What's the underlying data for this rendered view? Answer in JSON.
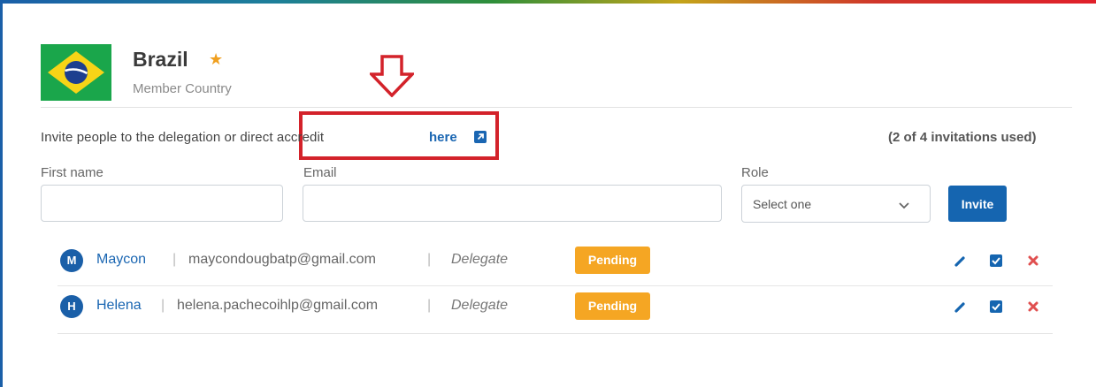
{
  "country": {
    "name": "Brazil",
    "star": "★",
    "subtitle": "Member Country"
  },
  "invite": {
    "text": "Invite people to the delegation or direct accredit",
    "link_label": "here",
    "usage": "(2 of 4 invitations used)"
  },
  "form": {
    "first_name_label": "First name",
    "first_name_value": "",
    "email_label": "Email",
    "email_value": "",
    "role_label": "Role",
    "role_selected": "Select one",
    "invite_button": "Invite"
  },
  "invitations": [
    {
      "initial": "M",
      "name": "Maycon",
      "email": "maycondougbatp@gmail.com",
      "role": "Delegate",
      "status": "Pending"
    },
    {
      "initial": "H",
      "name": "Helena",
      "email": "helena.pachecoihlp@gmail.com",
      "role": "Delegate",
      "status": "Pending"
    }
  ],
  "separator": "|",
  "icons": [
    "star-icon",
    "external-link-icon",
    "chevron-down-icon",
    "pencil-icon",
    "checkbox-icon",
    "close-icon",
    "arrow-down-icon"
  ],
  "colors": {
    "primary": "#1565b0",
    "link": "#1a66b2",
    "pending": "#f5a623",
    "delete": "#e05050",
    "annotation": "#d3222a",
    "star": "#f0a020"
  }
}
